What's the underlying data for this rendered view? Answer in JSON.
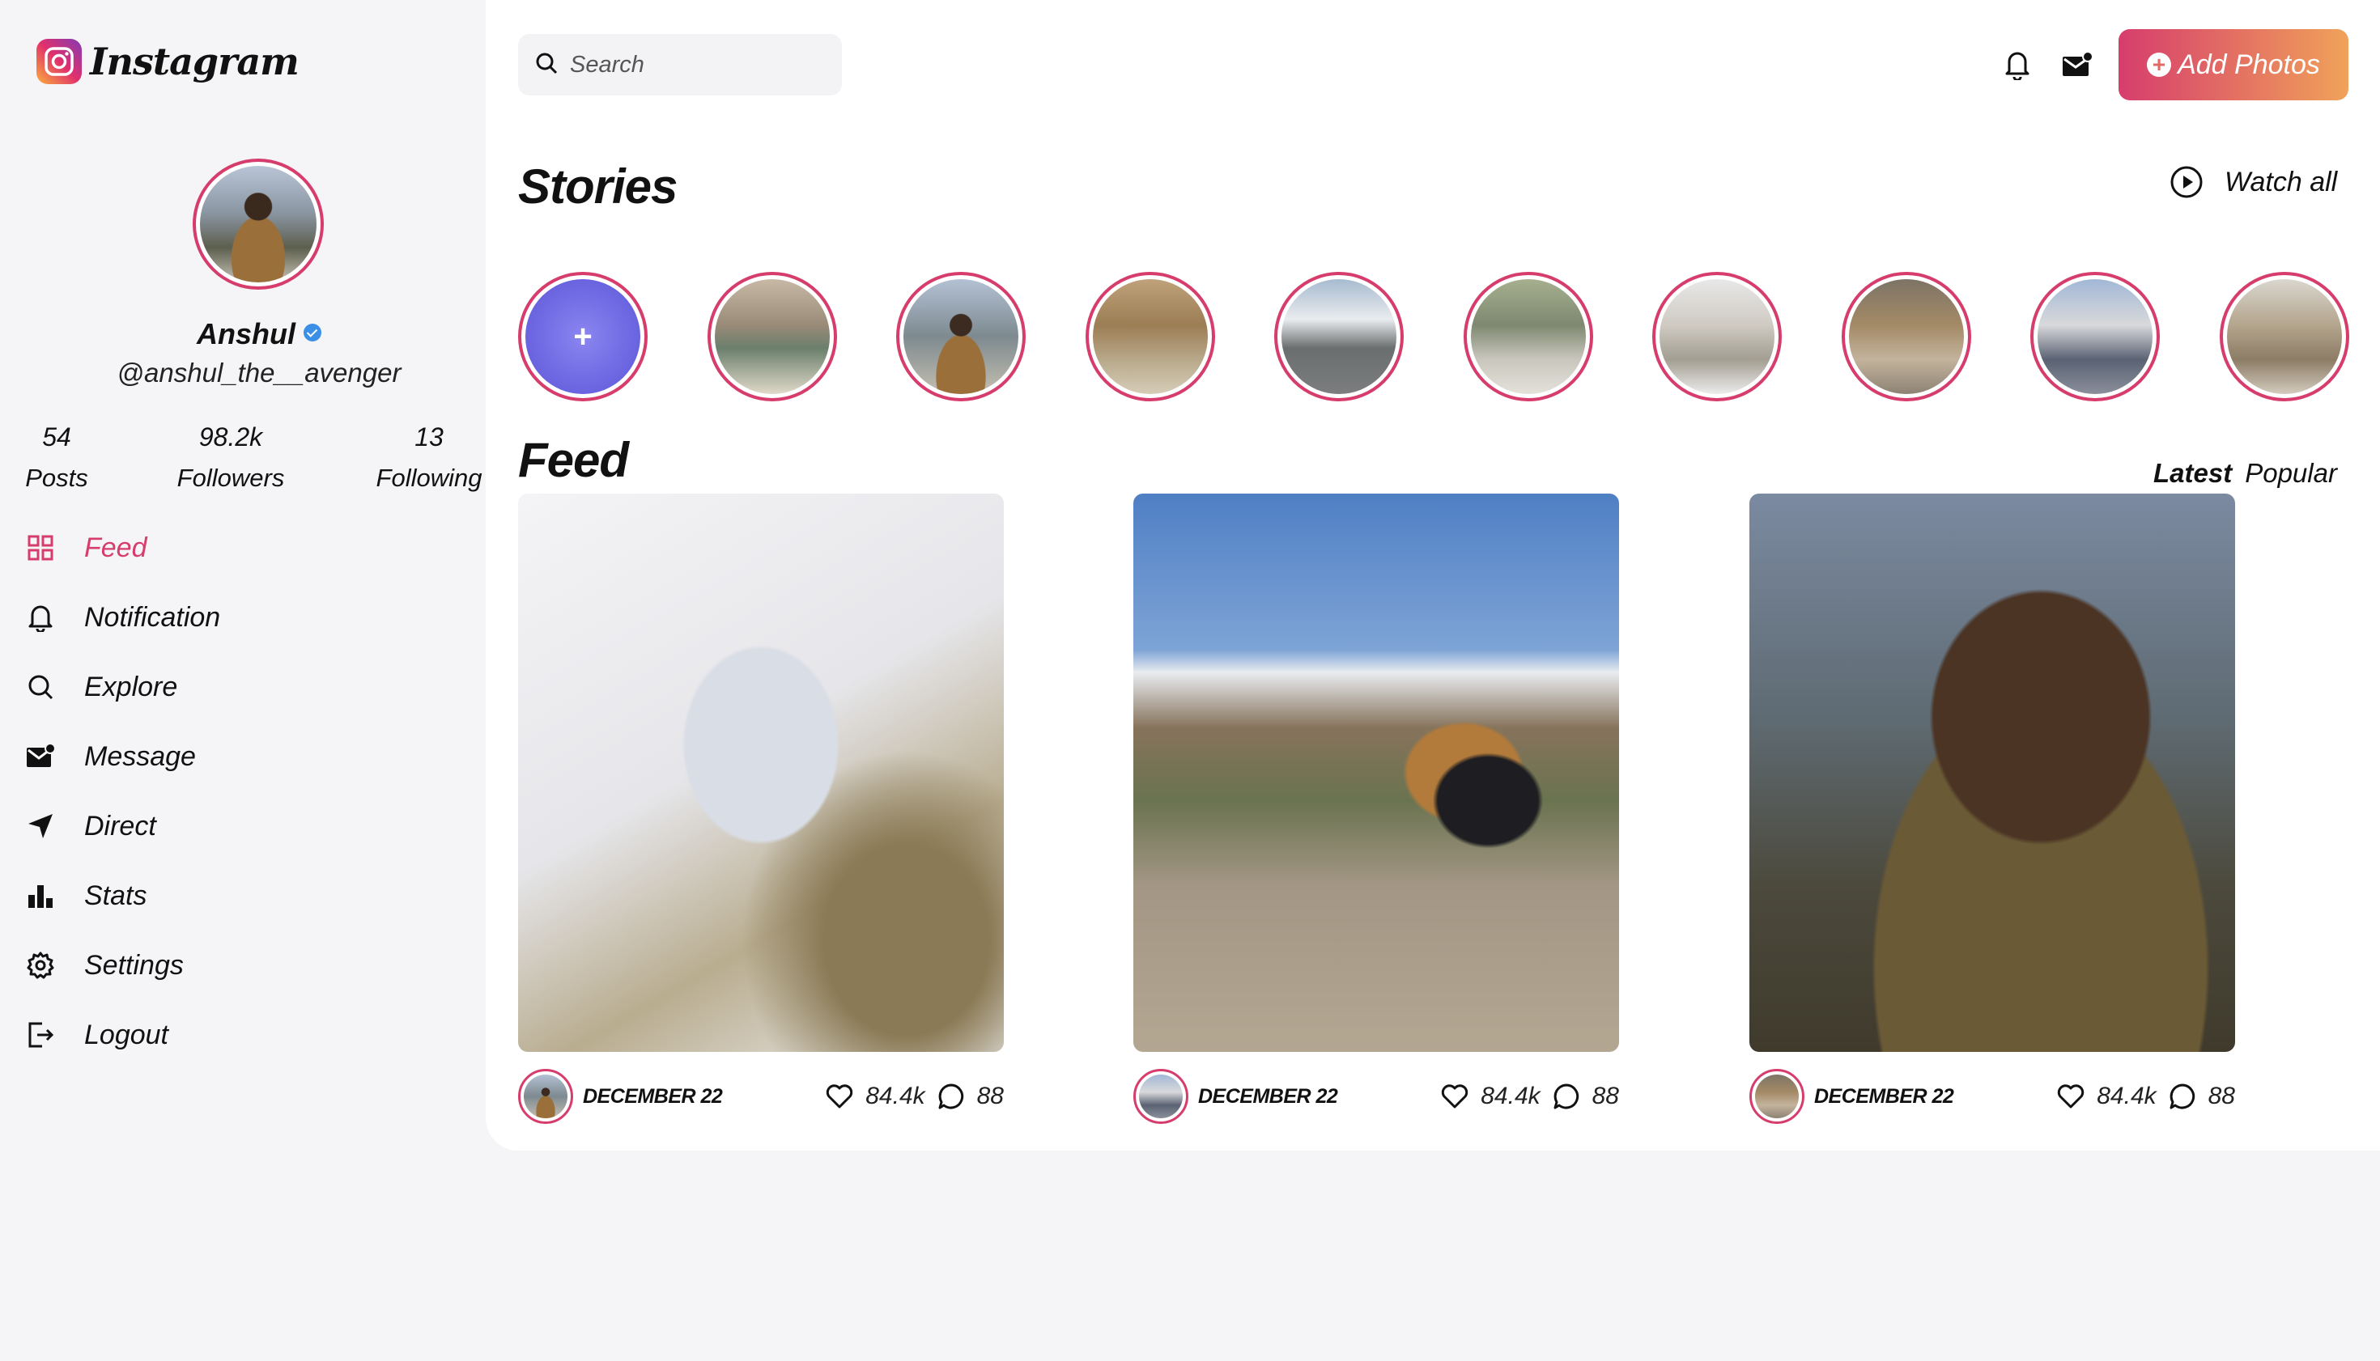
{
  "app": {
    "logo_text": "Instagram"
  },
  "profile": {
    "name": "Anshul",
    "handle": "@anshul_the__avenger",
    "stats": {
      "posts_value": "54",
      "posts_label": "Posts",
      "followers_value": "98.2k",
      "followers_label": "Followers",
      "following_value": "13",
      "following_label": "Following"
    }
  },
  "nav": {
    "items": [
      {
        "label": "Feed",
        "icon": "grid-icon",
        "active": true
      },
      {
        "label": "Notification",
        "icon": "bell-icon"
      },
      {
        "label": "Explore",
        "icon": "search-icon"
      },
      {
        "label": "Message",
        "icon": "mail-icon"
      },
      {
        "label": "Direct",
        "icon": "send-icon"
      },
      {
        "label": "Stats",
        "icon": "bar-chart-icon"
      },
      {
        "label": "Settings",
        "icon": "gear-icon"
      },
      {
        "label": "Logout",
        "icon": "logout-icon"
      }
    ]
  },
  "header": {
    "search_placeholder": "Search",
    "add_photos_label": "Add Photos"
  },
  "stories": {
    "title": "Stories",
    "watch_all_label": "Watch all",
    "add_symbol": "+"
  },
  "feed": {
    "title": "Feed",
    "tabs": {
      "latest": "Latest",
      "popular": "Popular"
    },
    "posts": [
      {
        "date": "DECEMBER 22",
        "likes": "84.4k",
        "comments": "88"
      },
      {
        "date": "DECEMBER 22",
        "likes": "84.4k",
        "comments": "88"
      },
      {
        "date": "DECEMBER 22",
        "likes": "84.4k",
        "comments": "88"
      }
    ]
  },
  "colors": {
    "accent": "#d63d6c",
    "gradient_end": "#f0a25a",
    "verified": "#3b8fe6"
  }
}
